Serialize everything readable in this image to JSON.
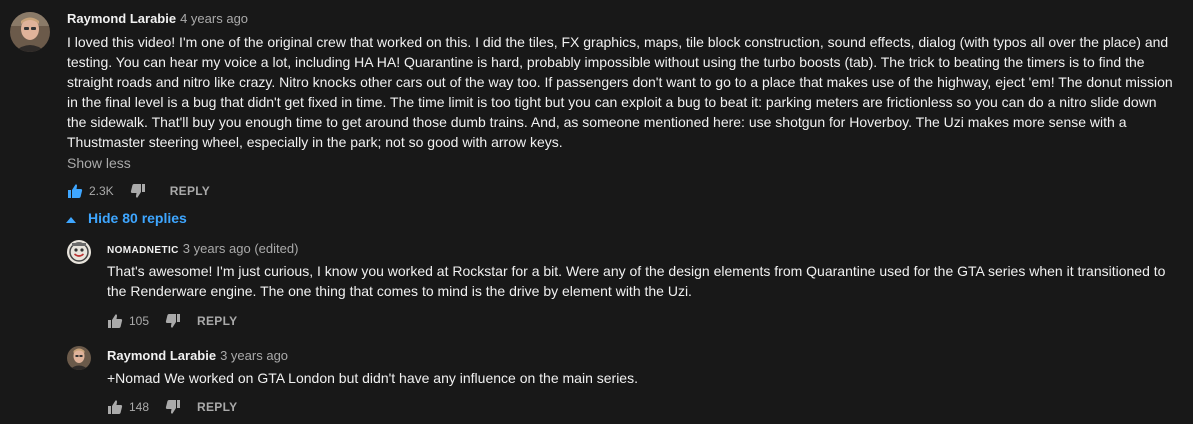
{
  "top_comment": {
    "author": "Raymond Larabie",
    "time": "4 years ago",
    "text": "I loved this video! I'm one of the original crew that worked on this. I did the tiles, FX graphics, maps, tile block construction, sound effects, dialog (with typos all over the place) and testing. You can hear my voice a lot, including HA HA! Quarantine is hard, probably impossible without using the turbo boosts (tab). The trick to beating the timers is to find the straight roads and nitro like crazy. Nitro knocks other cars out of the way too. If passengers don't want to go to a place that makes use of the highway, eject 'em! The donut mission in the final level is a bug that didn't get fixed in time. The time limit is too tight but you can exploit a bug to beat it: parking meters are frictionless so you can do a nitro slide down the sidewalk. That'll buy you enough time to get around those dumb trains. And, as someone mentioned here: use shotgun for Hoverboy. The Uzi makes more sense with a Thustmaster steering wheel, especially in the park; not so good with arrow keys.",
    "show_less": "Show less",
    "likes": "2.3K",
    "reply_label": "REPLY",
    "icons": {
      "like": "thumbs-up-icon",
      "dislike": "thumbs-down-icon"
    },
    "like_color": "#3ea6ff"
  },
  "replies_toggle": {
    "label": "Hide 80 replies",
    "icon": "caret-up-icon"
  },
  "replies": [
    {
      "author": "NOMADNETIC",
      "time": "3 years ago (edited)",
      "text": "That's awesome! I'm just curious, I know you worked at Rockstar for a bit. Were any of the design elements from Quarantine used for the GTA series when it transitioned to the Renderware engine. The one thing that comes to mind is the drive by element with the Uzi.",
      "likes": "105",
      "reply_label": "REPLY"
    },
    {
      "author": "Raymond Larabie",
      "time": "3 years ago",
      "text": "+Nomad We worked on GTA London but didn't have any influence on the main series.",
      "likes": "148",
      "reply_label": "REPLY"
    }
  ],
  "colors": {
    "background": "#181818",
    "text": "#f1f1f1",
    "secondary": "#aaaaaa",
    "link": "#3ea6ff"
  }
}
